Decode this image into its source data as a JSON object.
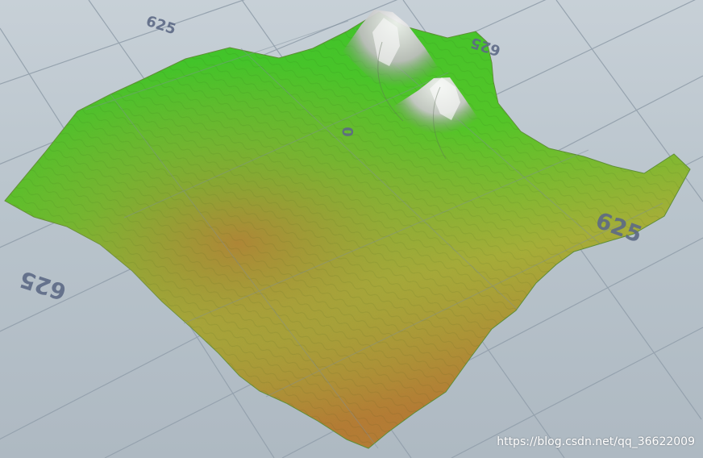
{
  "viewport": {
    "grid_labels": {
      "top_left": "625",
      "top_right": "625",
      "right": "625",
      "left": "625",
      "center": "0"
    }
  },
  "watermark": {
    "text": "https://blog.csdn.net/qq_36622009"
  },
  "colors": {
    "background": "#b9c4cc",
    "grid_line": "#8e9ba7",
    "terrain_green": "#3ccf2a",
    "terrain_orange": "#b97d32",
    "terrain_peak": "#d9d9d9",
    "label_color": "#5d6a86"
  }
}
